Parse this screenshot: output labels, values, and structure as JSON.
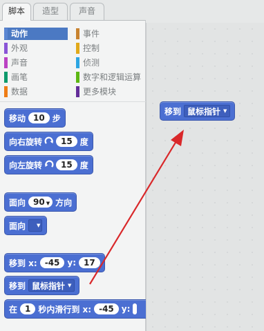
{
  "tabs": [
    {
      "label": "脚本",
      "active": true
    },
    {
      "label": "造型",
      "active": false
    },
    {
      "label": "声音",
      "active": false
    }
  ],
  "categories": [
    {
      "label": "动作",
      "color": "#4a6cd4",
      "selected": true
    },
    {
      "label": "外观",
      "color": "#8a55d7",
      "selected": false
    },
    {
      "label": "声音",
      "color": "#bb42c3",
      "selected": false
    },
    {
      "label": "画笔",
      "color": "#0e9a6c",
      "selected": false
    },
    {
      "label": "数据",
      "color": "#ee7d16",
      "selected": false
    },
    {
      "label": "事件",
      "color": "#c88330",
      "selected": false
    },
    {
      "label": "控制",
      "color": "#e1a91a",
      "selected": false
    },
    {
      "label": "侦测",
      "color": "#2ca5e2",
      "selected": false
    },
    {
      "label": "数字和逻辑运算",
      "color": "#5cb712",
      "selected": false
    },
    {
      "label": "更多模块",
      "color": "#632d99",
      "selected": false
    }
  ],
  "blocks": {
    "move": {
      "label": "移动",
      "steps": "10",
      "unit": "步"
    },
    "turn_right": {
      "label": "向右旋转",
      "degrees": "15",
      "unit": "度"
    },
    "turn_left": {
      "label": "向左旋转",
      "degrees": "15",
      "unit": "度"
    },
    "point_dir": {
      "label": "面向",
      "value": "90",
      "suffix": "方向"
    },
    "point_towards": {
      "label": "面向",
      "value": ""
    },
    "goto_xy": {
      "label": "移到 x:",
      "x": "-45",
      "ylabel": "y:",
      "y": "17"
    },
    "goto": {
      "label": "移到",
      "target": "鼠标指针"
    },
    "glide": {
      "label": "在",
      "secs": "1",
      "mid": "秒内滑行到 x:",
      "x": "-45",
      "ylabel": "y:"
    }
  },
  "script_area": {
    "goto_block": {
      "label": "移到",
      "target": "鼠标指针"
    }
  },
  "colors": {
    "motion_block": "#4b6fd2",
    "arrow": "#d9282a"
  }
}
